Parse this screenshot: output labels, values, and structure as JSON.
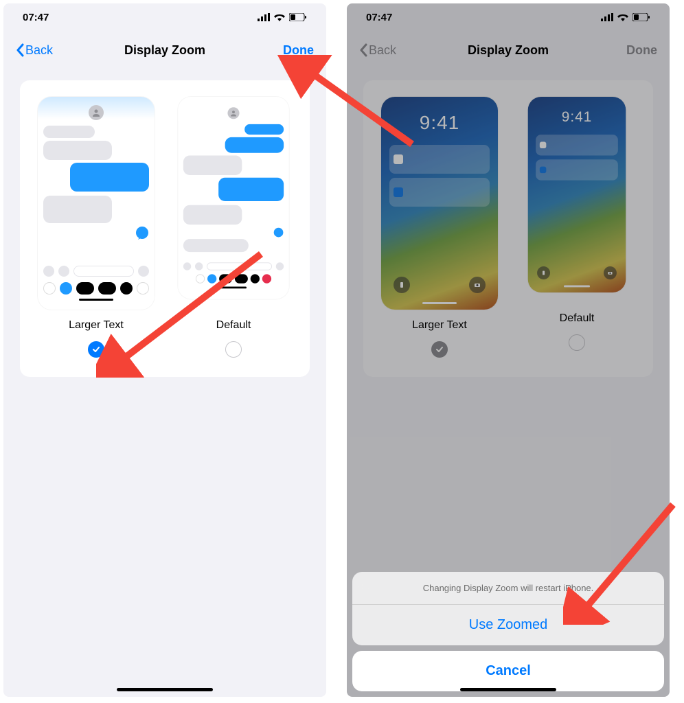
{
  "status": {
    "time": "07:47"
  },
  "nav": {
    "back": "Back",
    "title": "Display Zoom",
    "done": "Done"
  },
  "options": {
    "larger": "Larger Text",
    "default": "Default"
  },
  "lockscreen": {
    "time": "9:41"
  },
  "sheet": {
    "message": "Changing Display Zoom will restart iPhone.",
    "use_zoomed": "Use Zoomed",
    "cancel": "Cancel"
  },
  "colors": {
    "accent": "#007aff",
    "grey": "#8e8e93"
  }
}
